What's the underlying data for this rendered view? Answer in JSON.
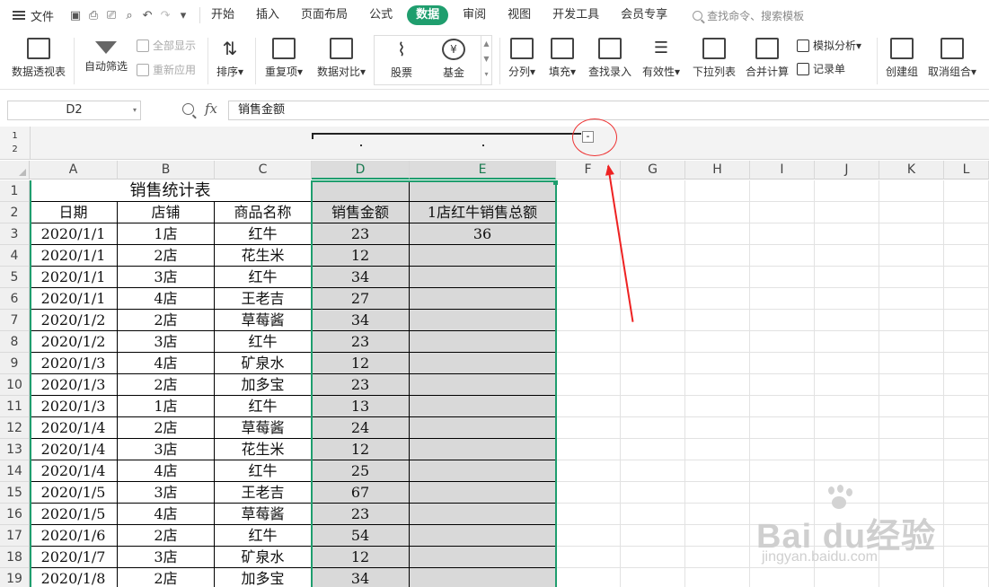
{
  "menu": {
    "file_label": "文件",
    "tabs": [
      "开始",
      "插入",
      "页面布局",
      "公式",
      "数据",
      "审阅",
      "视图",
      "开发工具",
      "会员专享"
    ],
    "active_tab": "数据",
    "search_placeholder": "查找命令、搜索模板"
  },
  "ribbon": {
    "pivot": "数据透视表",
    "autofilter": "自动筛选",
    "show_all": "全部显示",
    "reapply": "重新应用",
    "sort": "排序",
    "duplicates": "重复项",
    "compare": "数据对比",
    "stocks": "股票",
    "funds": "基金",
    "split": "分列",
    "fill": "填充",
    "lookup": "查找录入",
    "validity": "有效性",
    "dropdown_list": "下拉列表",
    "consolidate": "合并计算",
    "simulation": "模拟分析",
    "record_sheet": "记录单",
    "group": "创建组",
    "ungroup": "取消组合"
  },
  "formula_bar": {
    "name_box": "D2",
    "fx": "fx",
    "content": "销售金额"
  },
  "outline": {
    "levels": [
      "1",
      "2"
    ],
    "collapse_symbol": "-"
  },
  "sheet": {
    "columns": [
      "A",
      "B",
      "C",
      "D",
      "E",
      "F",
      "G",
      "H",
      "I",
      "J",
      "K",
      "L"
    ],
    "rows": [
      "1",
      "2",
      "3",
      "4",
      "5",
      "6",
      "7",
      "8",
      "9",
      "10",
      "11",
      "12",
      "13",
      "14",
      "15",
      "16",
      "17",
      "18",
      "19"
    ],
    "title": "销售统计表",
    "headers": [
      "日期",
      "店铺",
      "商品名称",
      "销售金额",
      "1店红牛销售总额"
    ],
    "data": [
      [
        "2020/1/1",
        "1店",
        "红牛",
        "23",
        "36"
      ],
      [
        "2020/1/1",
        "2店",
        "花生米",
        "12",
        ""
      ],
      [
        "2020/1/1",
        "3店",
        "红牛",
        "34",
        ""
      ],
      [
        "2020/1/1",
        "4店",
        "王老吉",
        "27",
        ""
      ],
      [
        "2020/1/2",
        "2店",
        "草莓酱",
        "34",
        ""
      ],
      [
        "2020/1/2",
        "3店",
        "红牛",
        "23",
        ""
      ],
      [
        "2020/1/3",
        "4店",
        "矿泉水",
        "12",
        ""
      ],
      [
        "2020/1/3",
        "2店",
        "加多宝",
        "23",
        ""
      ],
      [
        "2020/1/3",
        "1店",
        "红牛",
        "13",
        ""
      ],
      [
        "2020/1/4",
        "2店",
        "草莓酱",
        "24",
        ""
      ],
      [
        "2020/1/4",
        "3店",
        "花生米",
        "12",
        ""
      ],
      [
        "2020/1/4",
        "4店",
        "红牛",
        "25",
        ""
      ],
      [
        "2020/1/5",
        "3店",
        "王老吉",
        "67",
        ""
      ],
      [
        "2020/1/5",
        "4店",
        "草莓酱",
        "23",
        ""
      ],
      [
        "2020/1/6",
        "2店",
        "红牛",
        "54",
        ""
      ],
      [
        "2020/1/7",
        "3店",
        "矿泉水",
        "12",
        ""
      ],
      [
        "2020/1/8",
        "2店",
        "加多宝",
        "34",
        ""
      ]
    ]
  },
  "watermark": {
    "brand": "Bai du经验",
    "url": "jingyan.baidu.com"
  },
  "colors": {
    "accent": "#1f9e6e",
    "selection_fill": "#d9d9d9",
    "annotation": "#e22222"
  }
}
